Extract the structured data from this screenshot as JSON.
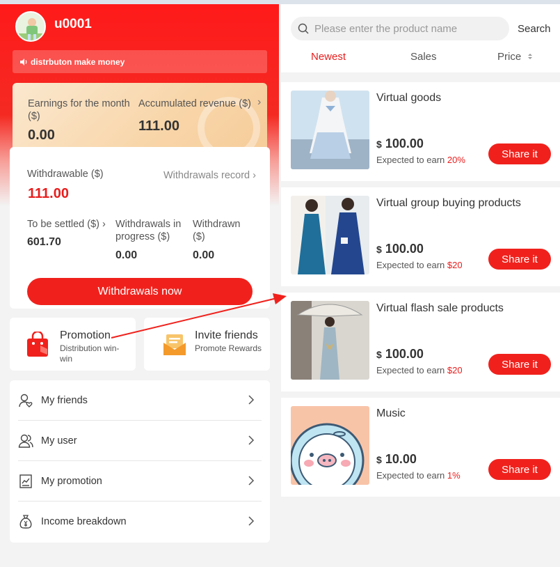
{
  "profile": {
    "username": "u0001"
  },
  "notice": {
    "text": "distrbuton make money"
  },
  "earnings": {
    "month_label": "Earnings for the month ($)",
    "month_value": "0.00",
    "accum_label": "Accumulated revenue ($)",
    "accum_value": "111.00"
  },
  "withdraw": {
    "label": "Withdrawable ($)",
    "amount": "111.00",
    "record_link": "Withdrawals record",
    "settled_label": "To be settled ($)",
    "settled_value": "601.70",
    "progress_label": "Withdrawals in progress ($)",
    "progress_value": "0.00",
    "withdrawn_label": "Withdrawn ($)",
    "withdrawn_value": "0.00",
    "button": "Withdrawals now"
  },
  "promotion": {
    "title": "Promotion",
    "subtitle": "Distribution win-win"
  },
  "invite": {
    "title": "Invite friends",
    "subtitle": "Promote Rewards"
  },
  "menu": [
    {
      "label": "My friends",
      "icon": "friends-icon"
    },
    {
      "label": "My user",
      "icon": "users-icon"
    },
    {
      "label": "My promotion",
      "icon": "chart-icon"
    },
    {
      "label": "Income breakdown",
      "icon": "money-bag-icon"
    }
  ],
  "search": {
    "placeholder": "Please enter the product name",
    "button": "Search"
  },
  "tabs": [
    {
      "label": "Newest"
    },
    {
      "label": "Sales"
    },
    {
      "label": "Price"
    }
  ],
  "products": [
    {
      "name": "Virtual goods",
      "currency": "$",
      "price": "100.00",
      "expected_label": "Expected to earn",
      "expected_value": "20%",
      "share": "Share it"
    },
    {
      "name": "Virtual group buying products",
      "currency": "$",
      "price": "100.00",
      "expected_label": "Expected to earn",
      "expected_value": "$20",
      "share": "Share it"
    },
    {
      "name": "Virtual flash sale products",
      "currency": "$",
      "price": "100.00",
      "expected_label": "Expected to earn",
      "expected_value": "$20",
      "share": "Share it"
    },
    {
      "name": "Music",
      "currency": "$",
      "price": "10.00",
      "expected_label": "Expected to earn",
      "expected_value": "1%",
      "share": "Share it"
    }
  ],
  "colors": {
    "accent": "#f0211c",
    "price_red": "#e81d1d",
    "card_gold": "#f8d5a8"
  }
}
